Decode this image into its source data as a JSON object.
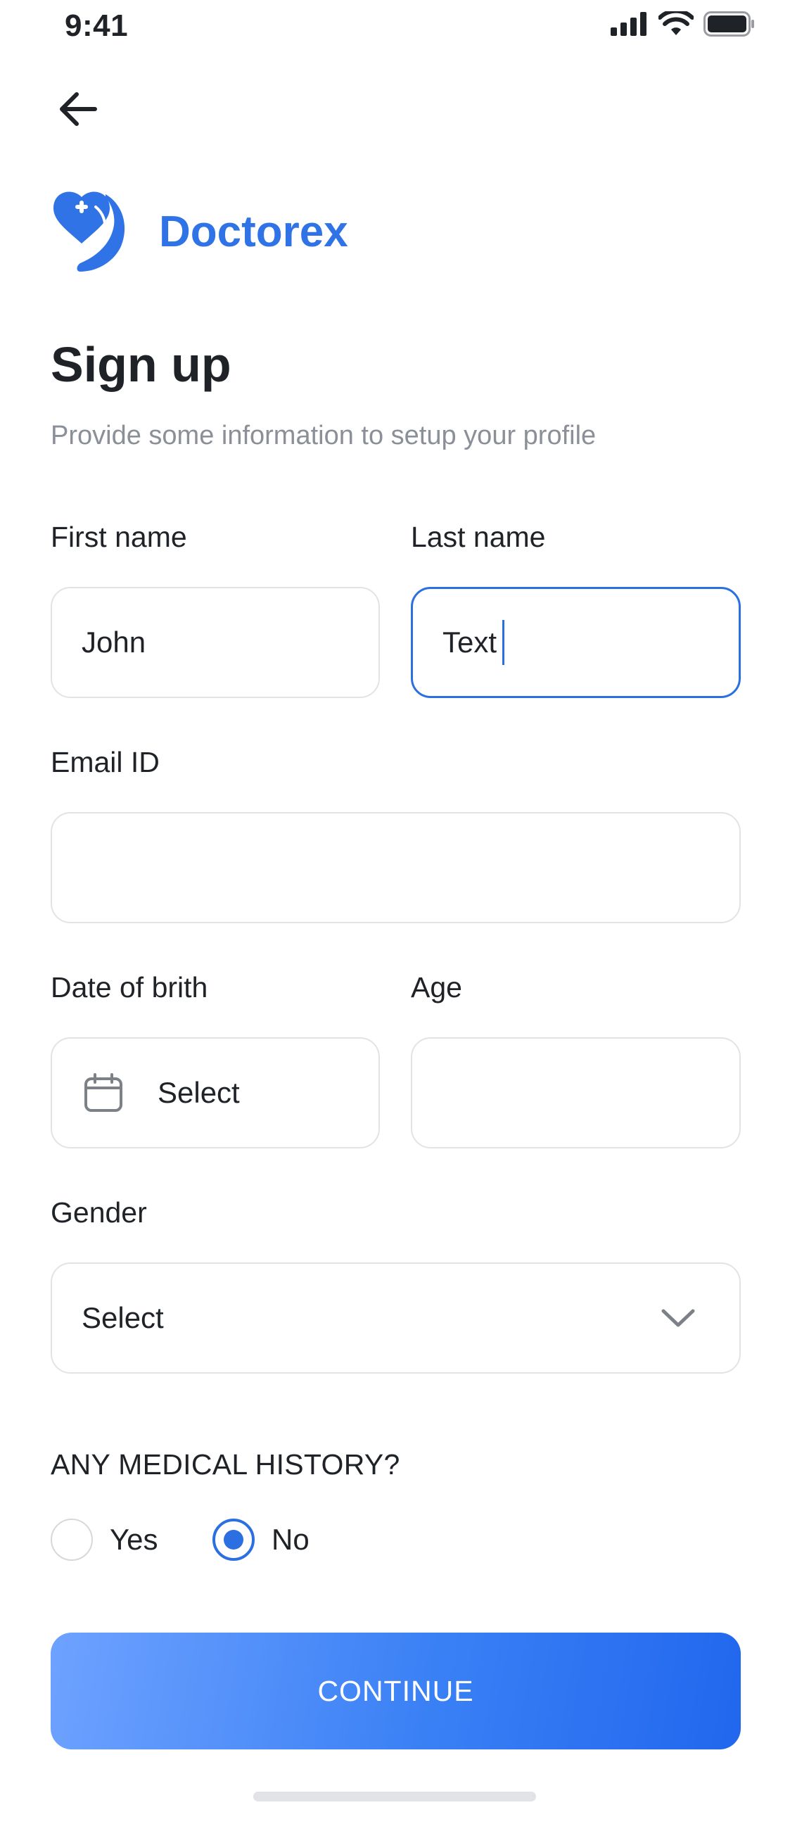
{
  "status_bar": {
    "time": "9:41"
  },
  "brand": {
    "name": "Doctorex",
    "color": "#2f73e6"
  },
  "page": {
    "title": "Sign up",
    "subtitle": "Provide some information to setup your profile"
  },
  "form": {
    "first_name": {
      "label": "First name",
      "value": "John"
    },
    "last_name": {
      "label": "Last name",
      "value": "Text",
      "focused": true
    },
    "email": {
      "label": "Email ID",
      "value": ""
    },
    "dob": {
      "label": "Date of brith",
      "value": "Select",
      "icon": "calendar-icon"
    },
    "age": {
      "label": "Age",
      "value": ""
    },
    "gender": {
      "label": "Gender",
      "value": "Select",
      "icon": "chevron-down-icon"
    }
  },
  "medical_history": {
    "heading": "ANY MEDICAL HISTORY?",
    "options": [
      {
        "label": "Yes",
        "checked": false
      },
      {
        "label": "No",
        "checked": true
      }
    ]
  },
  "cta": {
    "label": "CONTINUE"
  },
  "colors": {
    "accent": "#2b6fe0",
    "border": "#e3e3e6",
    "muted": "#8a8f98"
  }
}
